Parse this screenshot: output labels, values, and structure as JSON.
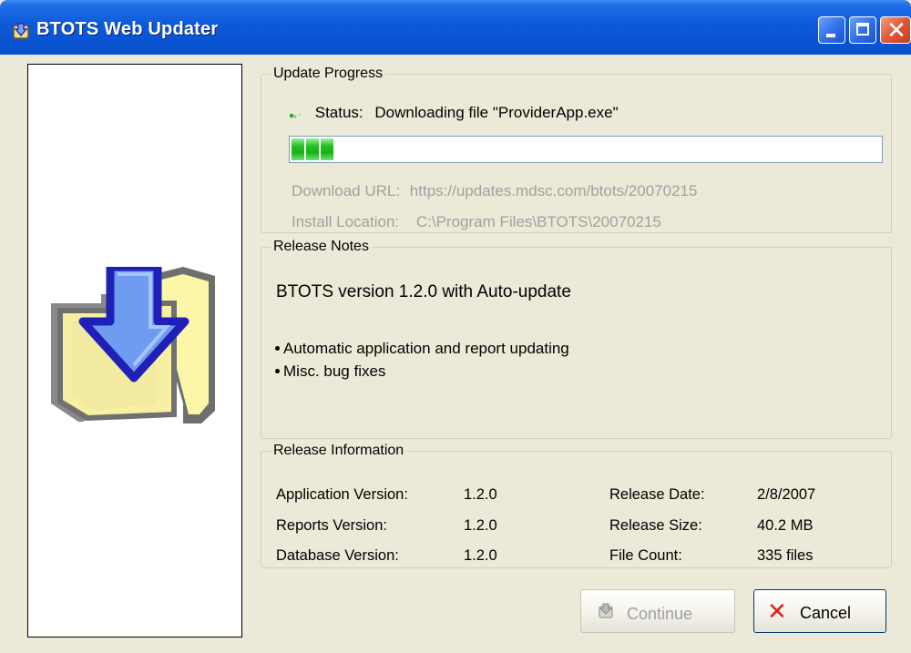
{
  "window": {
    "title": "BTOTS Web Updater",
    "icons": {
      "app": "app-updater-icon",
      "minimize": "minimize-icon",
      "maximize": "maximize-icon",
      "close": "close-icon"
    }
  },
  "sidebar": {
    "image_icon": "download-folder-icon"
  },
  "update_progress": {
    "legend": "Update Progress",
    "status_label": "Status:",
    "status_text": "Downloading file \"ProviderApp.exe\"",
    "progress_fraction": 0.07,
    "download_url_label": "Download URL:",
    "download_url": "https://updates.mdsc.com/btots/20070215",
    "install_location_label": "Install Location:",
    "install_location": "C:\\Program Files\\BTOTS\\20070215"
  },
  "release_notes": {
    "legend": "Release Notes",
    "heading": "BTOTS version 1.2.0 with Auto-update",
    "bullets": [
      "Automatic application and report updating",
      "Misc. bug fixes"
    ]
  },
  "release_info": {
    "legend": "Release Information",
    "rows": [
      {
        "label": "Application Version:",
        "value": "1.2.0",
        "label2": "Release Date:",
        "value2": "2/8/2007"
      },
      {
        "label": "Reports Version:",
        "value": "1.2.0",
        "label2": "Release Size:",
        "value2": "40.2 MB"
      },
      {
        "label": "Database Version:",
        "value": "1.2.0",
        "label2": "File Count:",
        "value2": "335 files"
      }
    ]
  },
  "buttons": {
    "continue_label": "Continue",
    "cancel_label": "Cancel",
    "cancel_icon_glyph": "✕"
  },
  "colors": {
    "title_bar": "#0a54d3",
    "progress_green": "#22c022",
    "close_button": "#e0583a"
  }
}
